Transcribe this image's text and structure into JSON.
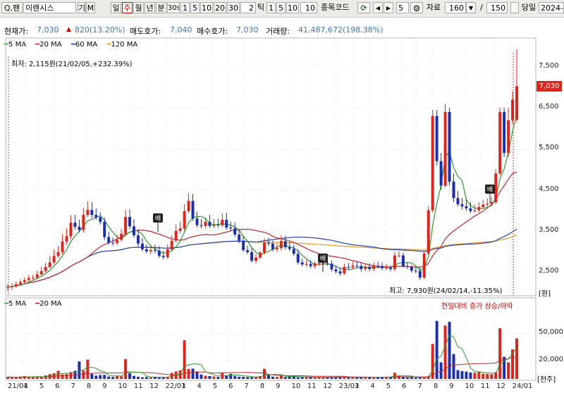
{
  "toolbar": {
    "search_label": "Q,팬",
    "stock_name": "이랜시스",
    "gi_label": "기",
    "m_label": "M",
    "periods": [
      "일",
      "주",
      "월",
      "년",
      "분",
      "30s",
      "1",
      "5",
      "10",
      "20",
      "30"
    ],
    "selected_period": "주",
    "tick_value": "2",
    "tick_label": "틱",
    "tick_counts": [
      "1",
      "5",
      "10"
    ],
    "field_value": "10",
    "code_label": "종목코드",
    "step_value": "5",
    "data_label": "자료",
    "data_count": "160",
    "slash": "/",
    "data_total": "150",
    "today_label": "당일",
    "date_value": "2024-0"
  },
  "info": {
    "price_label": "현재가:",
    "price": "7,030",
    "change": "820(13.20%)",
    "ask_label": "매도호가:",
    "ask": "7,040",
    "bid_label": "매수호가:",
    "bid": "7,030",
    "volume_label": "거래량:",
    "volume": "41,487,672(198.38%)"
  },
  "legend_top": [
    {
      "label": "5 MA",
      "color": "#2a9a2a"
    },
    {
      "label": "20 MA",
      "color": "#c0262c"
    },
    {
      "label": "60 MA",
      "color": "#2340a8"
    },
    {
      "label": "120 MA",
      "color": "#e39a1e"
    }
  ],
  "legend_bottom": [
    {
      "label": "5 MA",
      "color": "#2a9a2a"
    },
    {
      "label": "20 MA",
      "color": "#c0262c"
    }
  ],
  "annotations": {
    "low": "최저: 2,115원(21/02/05,+232.39%)",
    "high": "최고: 7,930원(24/02/14,-11.35%)",
    "volume_note": "전일대비 증가 상승/하락",
    "price_unit": "[원]",
    "volume_unit": "[천주]",
    "current_price": "7,030"
  },
  "colors": {
    "up": "#e0241c",
    "down": "#1c2fb0",
    "ma5": "#2a9a2a",
    "ma20": "#c0262c",
    "ma60": "#2340a8",
    "ma120": "#e39a1e"
  },
  "chart_data": {
    "type": "candlestick",
    "interval": "weekly",
    "price_ticks": [
      2500,
      3500,
      4500,
      5500,
      6500,
      7500
    ],
    "price_tick_labels": [
      "2,500",
      "3,500",
      "4,500",
      "5,500",
      "6,500",
      "7,500"
    ],
    "price_range": [
      1950,
      8100
    ],
    "volume_ticks": [
      20000,
      50000
    ],
    "volume_tick_labels": [
      "20,000",
      "50,000"
    ],
    "volume_range": [
      0,
      75000
    ],
    "x_labels": [
      "21/01",
      "4",
      "5",
      "6",
      "7",
      "8",
      "9",
      "10",
      "11",
      "12",
      "22/01",
      "3",
      "4",
      "5",
      "6",
      "7",
      "8",
      "9",
      "10",
      "11",
      "12",
      "23/01",
      "3",
      "4",
      "5",
      "6",
      "7",
      "8",
      "9",
      "10",
      "11",
      "12",
      "24/01"
    ],
    "close": [
      2130,
      2150,
      2200,
      2250,
      2300,
      2350,
      2360,
      2440,
      2520,
      2620,
      2730,
      2890,
      2980,
      3240,
      3370,
      3700,
      3600,
      3520,
      3890,
      4010,
      3890,
      3830,
      3720,
      3350,
      3210,
      3200,
      3280,
      3430,
      3840,
      3610,
      3390,
      3190,
      3050,
      3000,
      3030,
      3020,
      2890,
      2860,
      3050,
      3260,
      3500,
      3560,
      3980,
      4230,
      3800,
      3640,
      3620,
      3720,
      3620,
      3650,
      3640,
      3770,
      3580,
      3560,
      3410,
      3260,
      3030,
      2980,
      2770,
      2850,
      2970,
      3210,
      3190,
      3050,
      3080,
      3250,
      3100,
      3060,
      2940,
      2730,
      2680,
      2690,
      2640,
      2700,
      2710,
      2710,
      2700,
      2560,
      2510,
      2460,
      2620,
      2610,
      2650,
      2640,
      2570,
      2620,
      2570,
      2650,
      2640,
      2590,
      2600,
      2570,
      2900,
      2900,
      2640,
      2620,
      2530,
      2520,
      2360,
      2950,
      4000,
      6300,
      5200,
      4600,
      6400,
      4700,
      4300,
      4150,
      4100,
      4050,
      3980,
      4000,
      4080,
      4140,
      4160,
      4200,
      4900,
      6400,
      5400,
      6200,
      6700,
      7030
    ],
    "open": [
      2110,
      2130,
      2150,
      2200,
      2250,
      2300,
      2350,
      2360,
      2440,
      2520,
      2620,
      2730,
      2890,
      2980,
      3240,
      3370,
      3700,
      3600,
      3520,
      3890,
      4010,
      3890,
      3830,
      3720,
      3350,
      3210,
      3200,
      3280,
      3430,
      3840,
      3610,
      3390,
      3190,
      3050,
      3000,
      3030,
      3020,
      2890,
      2860,
      3050,
      3260,
      3500,
      3560,
      3980,
      4230,
      3800,
      3640,
      3620,
      3720,
      3620,
      3650,
      3640,
      3770,
      3580,
      3560,
      3410,
      3260,
      3030,
      2980,
      2770,
      2850,
      2970,
      3210,
      3190,
      3050,
      3080,
      3250,
      3100,
      3060,
      2940,
      2730,
      2680,
      2690,
      2640,
      2700,
      2710,
      2710,
      2700,
      2560,
      2510,
      2460,
      2620,
      2610,
      2650,
      2640,
      2570,
      2620,
      2570,
      2650,
      2640,
      2590,
      2600,
      2570,
      2900,
      2900,
      2640,
      2620,
      2530,
      2520,
      2360,
      2950,
      4000,
      6300,
      5200,
      4600,
      6400,
      4700,
      4300,
      4150,
      4100,
      4050,
      3980,
      4000,
      4080,
      4140,
      4160,
      4200,
      4900,
      6400,
      5400,
      6200,
      6210
    ],
    "high": [
      2200,
      2220,
      2270,
      2320,
      2370,
      2420,
      2430,
      2520,
      2620,
      2720,
      2880,
      3040,
      3130,
      3420,
      3560,
      3880,
      3890,
      3770,
      4060,
      4220,
      4200,
      4050,
      3950,
      3820,
      3480,
      3340,
      3400,
      3560,
      4010,
      4020,
      3780,
      3540,
      3330,
      3170,
      3150,
      3160,
      3130,
      3010,
      3170,
      3390,
      3650,
      3730,
      4150,
      4420,
      4400,
      3970,
      3790,
      3820,
      3890,
      3790,
      3800,
      3930,
      3940,
      3730,
      3700,
      3550,
      3380,
      3140,
      3090,
      2940,
      3010,
      3320,
      3330,
      3260,
      3200,
      3390,
      3380,
      3230,
      3160,
      3040,
      2820,
      2790,
      2790,
      2750,
      2800,
      2810,
      2810,
      2780,
      2660,
      2600,
      2700,
      2720,
      2750,
      2760,
      2730,
      2710,
      2710,
      2730,
      2750,
      2730,
      2700,
      2660,
      2980,
      3000,
      2970,
      2740,
      2670,
      2620,
      2600,
      3010,
      4100,
      6450,
      6450,
      5400,
      6600,
      6500,
      4900,
      4470,
      4300,
      4270,
      4200,
      4140,
      4200,
      4250,
      4290,
      4320,
      5000,
      6500,
      6500,
      6500,
      6900,
      7930
    ],
    "low": [
      2040,
      2060,
      2110,
      2160,
      2210,
      2260,
      2290,
      2330,
      2410,
      2490,
      2580,
      2680,
      2840,
      2930,
      3160,
      3300,
      3530,
      3460,
      3460,
      3840,
      3820,
      3770,
      3660,
      3280,
      3160,
      3140,
      3160,
      3240,
      3380,
      3540,
      3330,
      3120,
      3000,
      2950,
      2930,
      2950,
      2840,
      2800,
      2810,
      3000,
      3210,
      3440,
      3510,
      3930,
      3740,
      3580,
      3560,
      3560,
      3570,
      3570,
      3580,
      3590,
      3530,
      3500,
      3350,
      3200,
      2990,
      2930,
      2730,
      2700,
      2800,
      2920,
      3130,
      3000,
      2990,
      3020,
      3050,
      3010,
      2890,
      2680,
      2630,
      2630,
      2590,
      2590,
      2650,
      2660,
      2650,
      2510,
      2460,
      2410,
      2420,
      2560,
      2560,
      2590,
      2510,
      2520,
      2520,
      2520,
      2590,
      2540,
      2550,
      2520,
      2520,
      2850,
      2600,
      2570,
      2480,
      2460,
      2310,
      2320,
      2900,
      3950,
      5100,
      4500,
      4560,
      4600,
      4200,
      4100,
      4020,
      3990,
      3930,
      3940,
      3950,
      4030,
      4090,
      4110,
      4150,
      4850,
      5300,
      5300,
      6100,
      6150
    ],
    "volume": [
      2200,
      1800,
      1600,
      2500,
      3100,
      2400,
      2000,
      1900,
      2600,
      3800,
      5200,
      6100,
      8800,
      4800,
      5200,
      7400,
      8800,
      19000,
      9000,
      21000,
      5500,
      3600,
      4200,
      4400,
      2600,
      2200,
      3200,
      2800,
      21500,
      6200,
      3300,
      2400,
      1700,
      2100,
      1600,
      2200,
      1500,
      1900,
      2400,
      6600,
      8100,
      9200,
      42000,
      10800,
      11200,
      8200,
      4800,
      3400,
      3100,
      2600,
      2200,
      6400,
      3700,
      5600,
      3100,
      2400,
      2200,
      2100,
      2000,
      2200,
      3100,
      11000,
      5000,
      2400,
      2100,
      3600,
      2200,
      2800,
      2600,
      1800,
      2100,
      1900,
      1900,
      1600,
      1800,
      2100,
      1600,
      2200,
      2300,
      1900,
      1600,
      1800,
      1700,
      2000,
      1900,
      2200,
      1800,
      1700,
      2000,
      1800,
      2400,
      2300,
      6700,
      3500,
      1900,
      1700,
      1800,
      1500,
      2100,
      2200,
      3000,
      38000,
      63000,
      18000,
      58000,
      62000,
      27000,
      9500,
      8500,
      8000,
      7000,
      6700,
      8100,
      5800,
      5500,
      5200,
      7200,
      55000,
      24000,
      18000,
      32000,
      44000
    ]
  }
}
